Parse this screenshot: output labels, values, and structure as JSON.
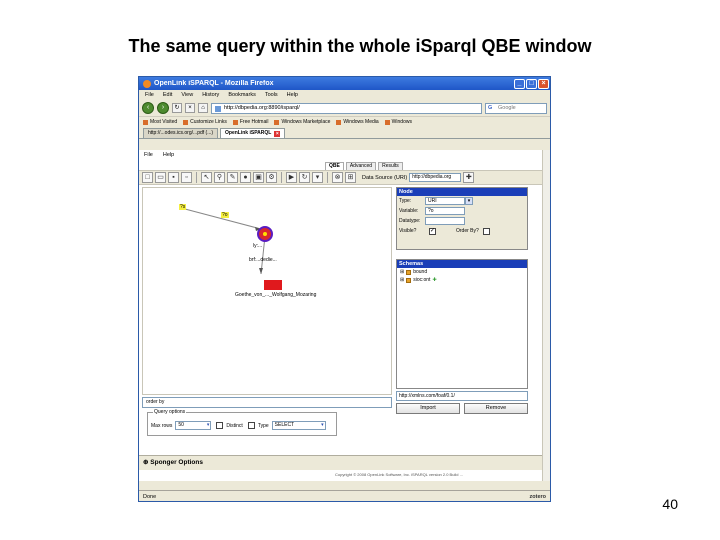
{
  "slide": {
    "title": "The same query within the whole iSparql QBE window",
    "page_number": "40"
  },
  "browser": {
    "window_title": "OpenLink iSPARQL - Mozilla Firefox",
    "menu": [
      "File",
      "Edit",
      "View",
      "History",
      "Bookmarks",
      "Tools",
      "Help"
    ],
    "url": "http://dbpedia.org:8890/isparql/",
    "search_placeholder": "Google",
    "bookmarks": [
      "Most Visited",
      "Customize Links",
      "Free Hotmail",
      "Windows Marketplace",
      "Windows Media",
      "Windows"
    ],
    "tabs": [
      {
        "label": "http://...odes.ics.org/...pdf (...)",
        "active": false
      },
      {
        "label": "OpenLink iSPARQL",
        "active": true
      }
    ],
    "status": "Done",
    "addon": "zotero"
  },
  "app": {
    "menu": [
      "File",
      "Help"
    ],
    "qbe_tabs": [
      "QBE",
      "Advanced",
      "Results"
    ],
    "data_source_label": "Data Source (URI)",
    "data_source_value": "http://dbpedia.org",
    "graph": {
      "nodes": [
        {
          "label": "?s",
          "kind": "var"
        },
        {
          "label": "?o",
          "kind": "var"
        }
      ],
      "edge_labels": [
        "ly:...",
        "brf:...dedie..."
      ],
      "resource_label": "Goethe_von_..._Wolfgang_Mozaring"
    },
    "node_panel": {
      "title": "Node",
      "type_label": "Type:",
      "type_value": "URI",
      "variable_label": "Variable:",
      "variable_value": "?o",
      "datatype_label": "Datatype:",
      "visible_label": "Visible?",
      "orderby_label": "Order By?"
    },
    "schemas": {
      "title": "Schemas",
      "items": [
        "bound",
        "sioc:ont"
      ],
      "url_value": "http://xmlns.com/foaf/0.1/",
      "import_label": "Import",
      "remove_label": "Remove"
    },
    "order_by_label": "order by",
    "query_options": {
      "legend": "Query options",
      "max_rows_label": "Max rows",
      "max_rows_value": "50",
      "distinct_label": "Distinct",
      "type_label": "Type",
      "type_value": "SELECT"
    },
    "sponger_label": "Sponger Options",
    "footer": "Copyright © 2008 OpenLink Software, Inc. iSPARQL version 2.0 Build ..."
  }
}
